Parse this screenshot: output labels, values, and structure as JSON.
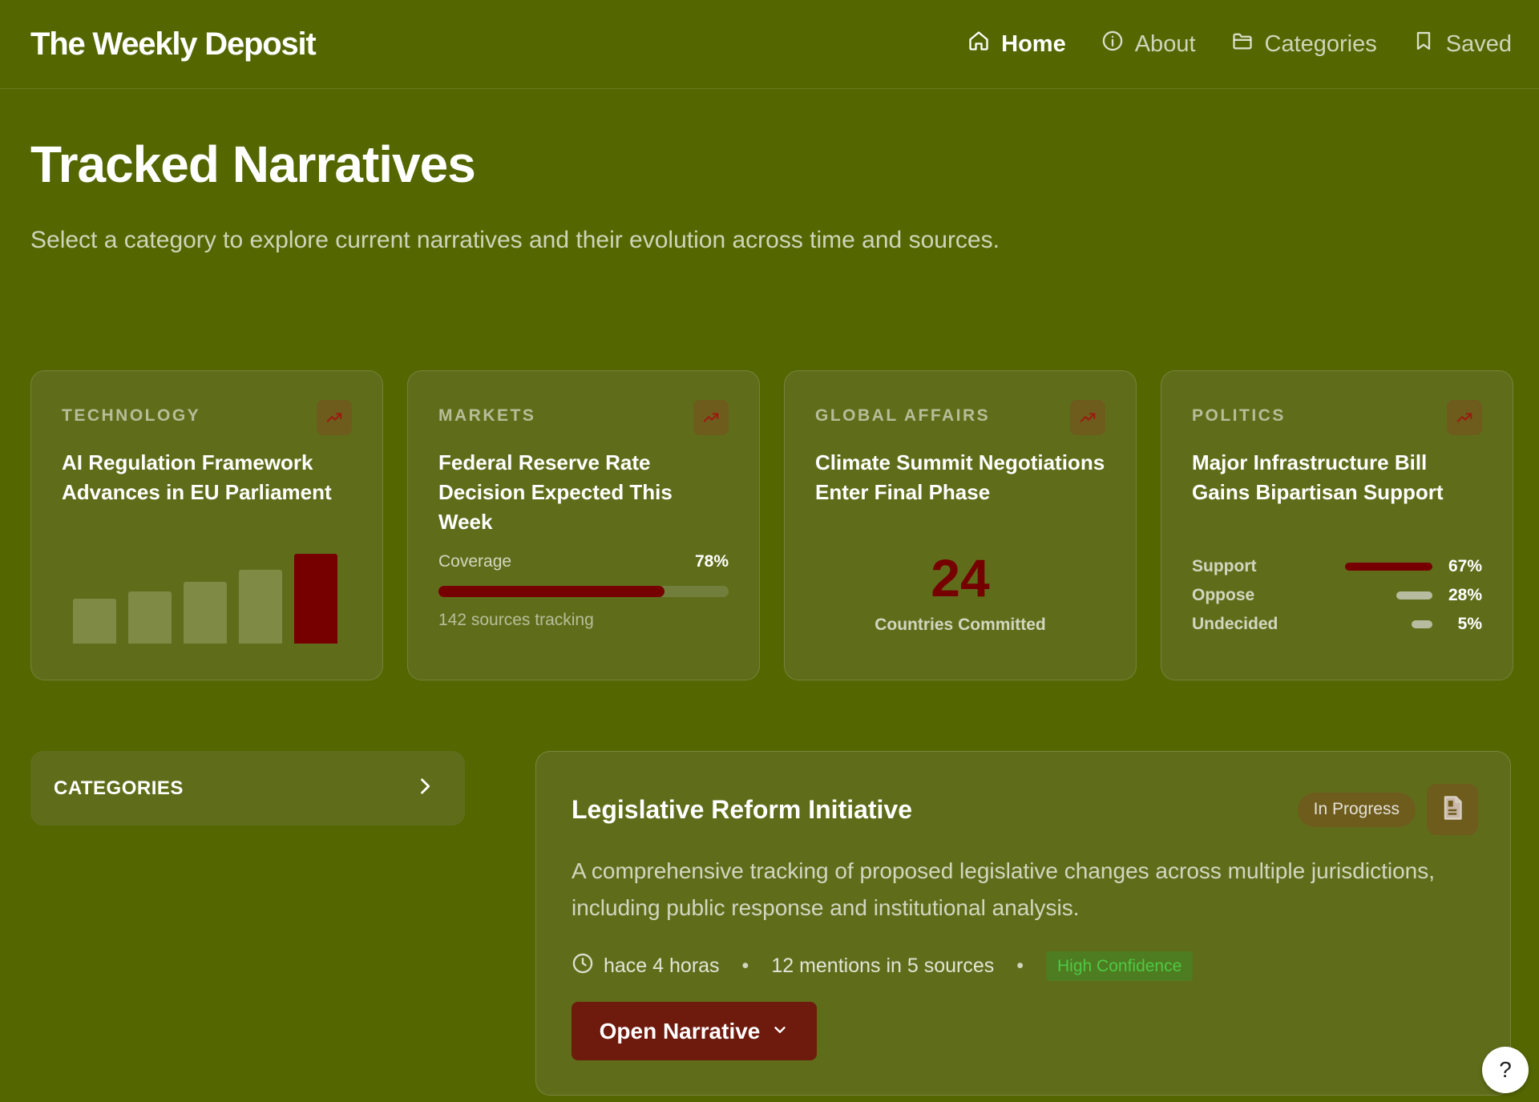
{
  "colors": {
    "background": "#546600",
    "card": "#5f6d1b",
    "accent": "#760000",
    "badge_brown": "#6e5c1c",
    "button_primary": "#6e1a0d",
    "success": "#4ec944"
  },
  "header": {
    "brand": "The Weekly Deposit",
    "nav": [
      {
        "label": "Home",
        "icon": "home-icon",
        "active": true
      },
      {
        "label": "About",
        "icon": "info-icon",
        "active": false
      },
      {
        "label": "Categories",
        "icon": "folder-icon",
        "active": false
      },
      {
        "label": "Saved",
        "icon": "bookmark-icon",
        "active": false
      }
    ]
  },
  "hero": {
    "title": "Tracked Narratives",
    "subtitle": "Select a category to explore current narratives and their evolution across time and sources."
  },
  "cards": [
    {
      "category": "TECHNOLOGY",
      "icon": "trending-up-icon",
      "title": "AI Regulation Framework Advances in EU Parliament",
      "trend": [
        0.5,
        0.58,
        0.69,
        0.82,
        1.0
      ]
    },
    {
      "category": "MARKETS",
      "icon": "trending-up-icon",
      "title": "Federal Reserve Rate Decision Expected This Week",
      "coverage_label": "Coverage",
      "coverage_value": "78%",
      "coverage_fraction": 0.78,
      "sources_text": "142 sources tracking"
    },
    {
      "category": "GLOBAL AFFAIRS",
      "icon": "trending-up-icon",
      "title": "Climate Summit Negotiations Enter Final Phase",
      "number": "24",
      "number_label": "Countries Committed"
    },
    {
      "category": "POLITICS",
      "icon": "trending-up-icon",
      "title": "Major Infrastructure Bill Gains Bipartisan Support",
      "poll": [
        {
          "label": "Support",
          "value": "67%",
          "fraction": 0.67,
          "color": "#760000"
        },
        {
          "label": "Oppose",
          "value": "28%",
          "fraction": 0.28,
          "color": "#b7bca0"
        },
        {
          "label": "Undecided",
          "value": "5%",
          "fraction": 0.05,
          "color": "#b7bca0"
        }
      ]
    }
  ],
  "categories_panel": {
    "label": "CATEGORIES",
    "icon": "chevron-right-icon"
  },
  "narrative": {
    "title": "Legislative Reform Initiative",
    "status": "In Progress",
    "doc_icon": "document-icon",
    "description": "A comprehensive tracking of proposed legislative changes across multiple jurisdictions, including public response and institutional analysis.",
    "time": "hace 4 horas",
    "mentions": "12 mentions in 5 sources",
    "separator": "•",
    "confidence": "High Confidence",
    "open_button": "Open Narrative"
  },
  "help": {
    "label": "?"
  }
}
